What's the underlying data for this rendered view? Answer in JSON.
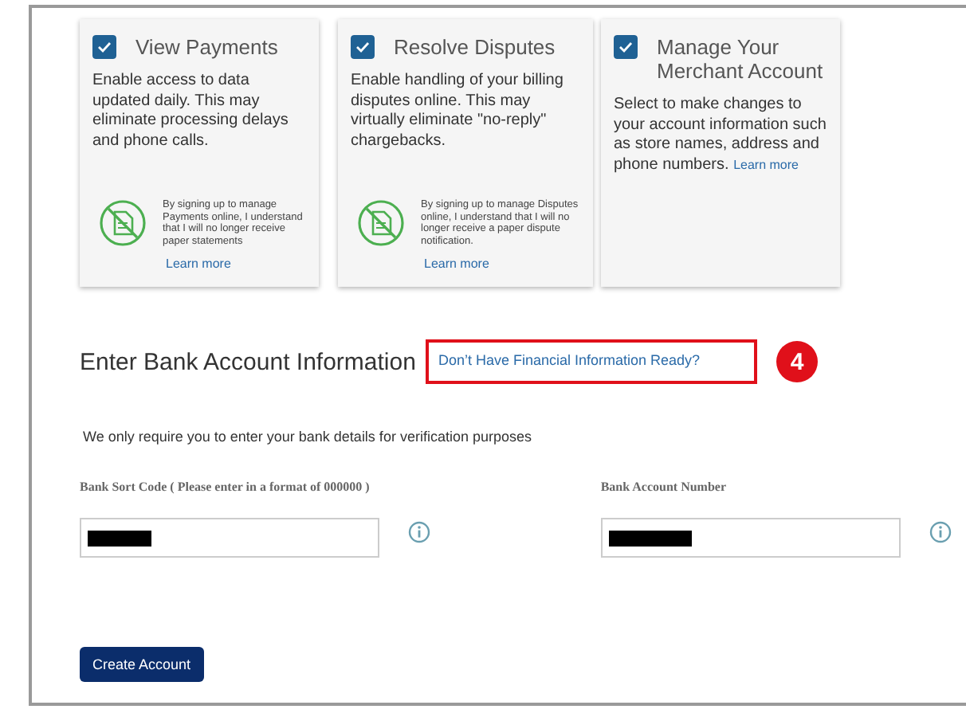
{
  "cards": [
    {
      "kind": "with-note",
      "title": "View Payments",
      "checked": true,
      "description": "Enable access to data updated daily. This may eliminate processing delays and phone calls.",
      "note": "By signing up to manage Payments online, I understand that I will no longer receive paper statements",
      "link": "Learn more"
    },
    {
      "kind": "with-note",
      "title": "Resolve Disputes",
      "checked": true,
      "description": "Enable handling of your billing disputes online. This may virtually eliminate \"no-reply\" chargebacks.",
      "note": "By signing up to manage Disputes online, I understand that I will no longer receive a paper dispute notification.",
      "link": "Learn more"
    },
    {
      "kind": "inline-link",
      "title": "Manage Your Merchant Account",
      "checked": true,
      "description": "Select to make changes to your account information such as store names, address and phone numbers.",
      "link": "Learn more"
    }
  ],
  "section": {
    "heading": "Enter Bank Account Information",
    "help_link": "Don’t Have Financial Information Ready?",
    "callout": "4"
  },
  "note": "We only require you to enter your bank details for verification purposes",
  "fields": [
    {
      "label": "Bank Sort Code ( Please enter in a format of 000000 )",
      "redacted": true
    },
    {
      "label": "Bank Account Number",
      "redacted": true
    }
  ],
  "button": "Create Account"
}
